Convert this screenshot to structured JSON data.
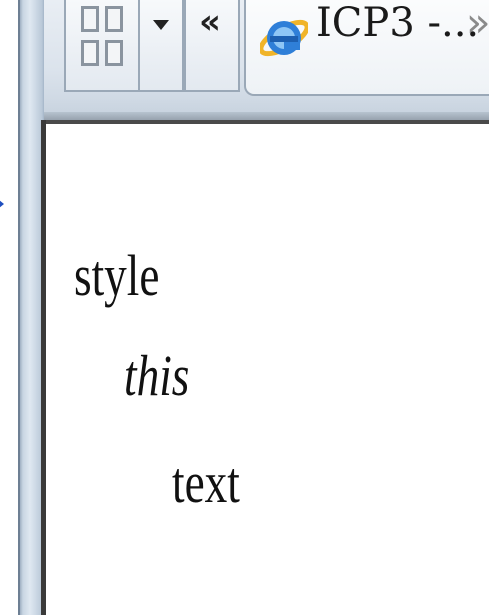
{
  "toolbar": {
    "grid_icon": "grid-view-icon",
    "dropdown_icon": "chevron-down-icon",
    "back_label": "«",
    "tab": {
      "icon": "internet-explorer-icon",
      "title": "ICP3 -...",
      "overflow_label": "»"
    }
  },
  "content": {
    "line1": "style",
    "line2": "this",
    "line3": "text"
  },
  "colors": {
    "frame": "#b9c8d8",
    "toolbar": "#dbe3ec",
    "text": "#111111",
    "accent_arrow": "#1f4fbf"
  }
}
